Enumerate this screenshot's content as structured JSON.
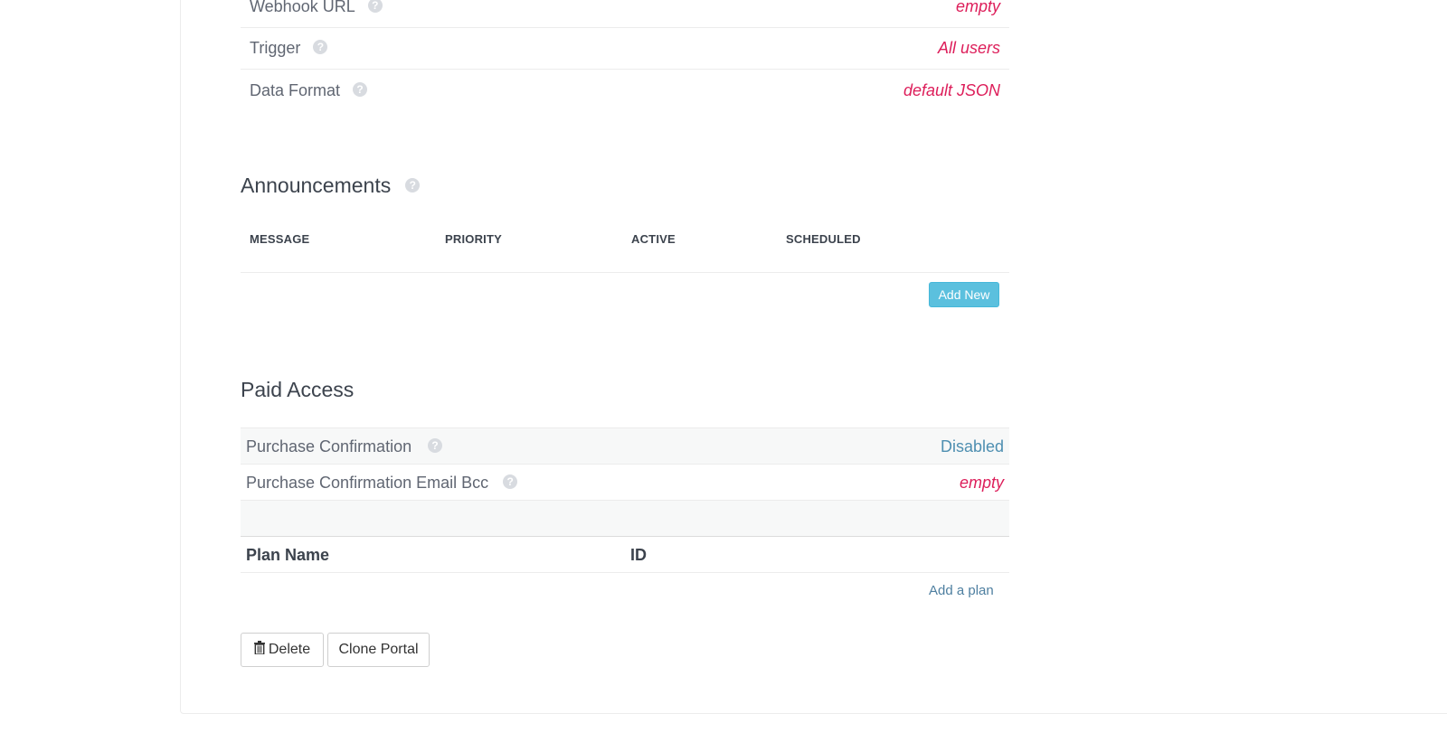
{
  "properties": {
    "rows": [
      {
        "label": "Webhook URL",
        "value": "empty"
      },
      {
        "label": "Trigger",
        "value": "All users"
      },
      {
        "label": "Data Format",
        "value": "default JSON"
      }
    ]
  },
  "announcements": {
    "title": "Announcements",
    "columns": [
      "MESSAGE",
      "PRIORITY",
      "ACTIVE",
      "SCHEDULED"
    ],
    "add_new_label": "Add New"
  },
  "paid_access": {
    "title": "Paid Access",
    "purchase_confirmation": {
      "label": "Purchase Confirmation",
      "value": "Disabled"
    },
    "purchase_confirmation_bcc": {
      "label": "Purchase Confirmation Email Bcc",
      "value": "empty"
    },
    "plan_table": {
      "columns": [
        "Plan Name",
        "ID"
      ],
      "add_plan_label": "Add a plan"
    }
  },
  "actions": {
    "delete_label": "Delete",
    "clone_label": "Clone Portal"
  },
  "colors": {
    "empty_value": "#dd1e5a",
    "link": "#4e8fb1",
    "add_new_button": "#5bc0de"
  }
}
